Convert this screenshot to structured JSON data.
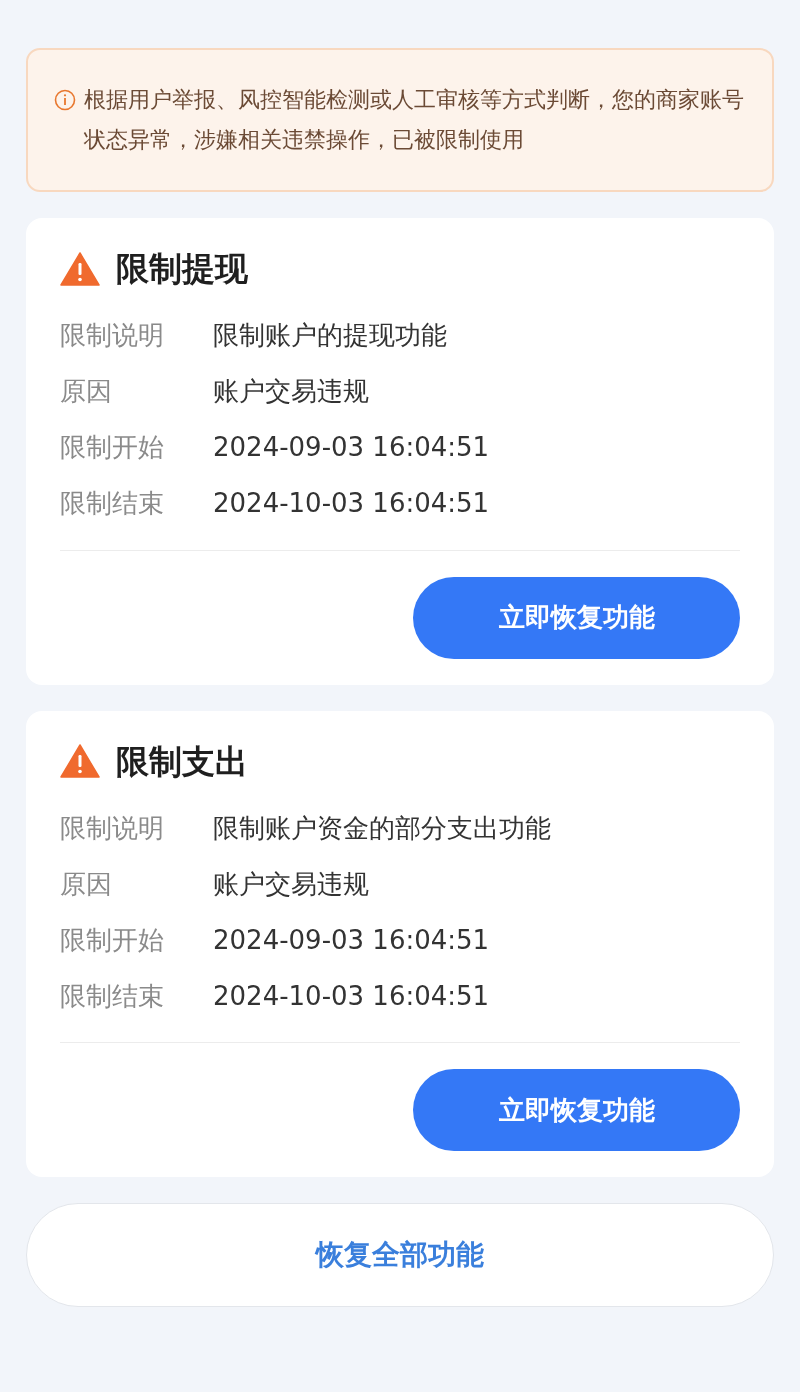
{
  "notice": {
    "text": "根据用户举报、风控智能检测或人工审核等方式判断，您的商家账号状态异常，涉嫌相关违禁操作，已被限制使用"
  },
  "restrictions": [
    {
      "title": "限制提现",
      "rows": [
        {
          "label": "限制说明",
          "value": "限制账户的提现功能"
        },
        {
          "label": "原因",
          "value": "账户交易违规"
        },
        {
          "label": "限制开始",
          "value": "2024-09-03 16:04:51"
        },
        {
          "label": "限制结束",
          "value": "2024-10-03 16:04:51"
        }
      ],
      "button": "立即恢复功能"
    },
    {
      "title": "限制支出",
      "rows": [
        {
          "label": "限制说明",
          "value": "限制账户资金的部分支出功能"
        },
        {
          "label": "原因",
          "value": "账户交易违规"
        },
        {
          "label": "限制开始",
          "value": "2024-09-03 16:04:51"
        },
        {
          "label": "限制结束",
          "value": "2024-10-03 16:04:51"
        }
      ],
      "button": "立即恢复功能"
    }
  ],
  "restore_all_button": "恢复全部功能"
}
